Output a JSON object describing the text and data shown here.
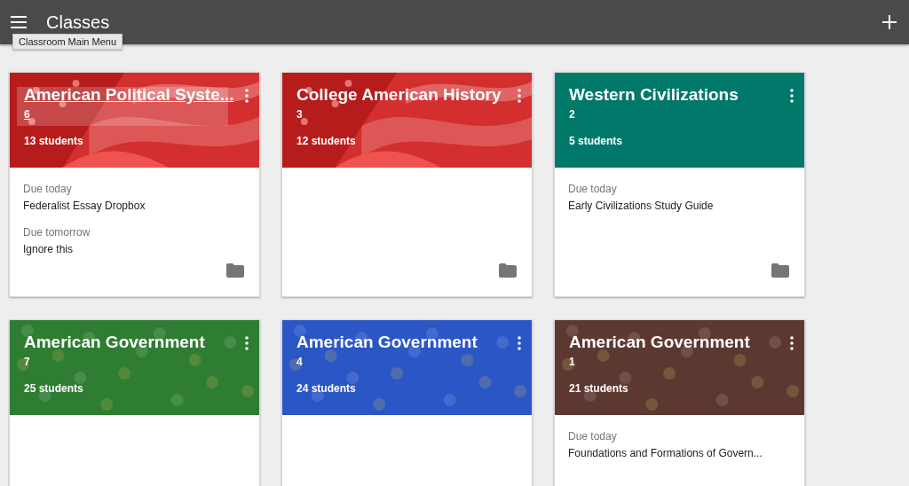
{
  "app_bar": {
    "title": "Classes",
    "menu_tooltip": "Classroom Main Menu"
  },
  "classes": [
    {
      "name": "American Political Syste...",
      "section": "6",
      "students": "13 students",
      "kind": "flag",
      "color": "#d32f2f",
      "hovered": true,
      "folder": true,
      "due": [
        {
          "label": "Due today",
          "item": "Federalist Essay Dropbox"
        },
        {
          "label": "Due tomorrow",
          "item": "Ignore this"
        }
      ]
    },
    {
      "name": "College American History",
      "section": "3",
      "students": "12 students",
      "kind": "flag",
      "color": "#d32f2f",
      "hovered": false,
      "folder": true
    },
    {
      "name": "Western Civilizations",
      "section": "2",
      "students": "5 students",
      "kind": "solid",
      "color": "#00796b",
      "hovered": false,
      "folder": true,
      "due": [
        {
          "label": "Due today",
          "item": "Early Civilizations Study Guide"
        }
      ]
    },
    {
      "name": "American Government",
      "section": "7",
      "students": "25 students",
      "kind": "dots",
      "color": "#2e7d32",
      "hovered": false
    },
    {
      "name": "American Government",
      "section": "4",
      "students": "24 students",
      "kind": "dots",
      "color": "#2b56c6",
      "hovered": false
    },
    {
      "name": "American Government",
      "section": "1",
      "students": "21 students",
      "kind": "dots",
      "color": "#5d3831",
      "hovered": false,
      "due": [
        {
          "label": "Due today",
          "item": "Foundations and Formations of Govern..."
        }
      ]
    }
  ]
}
